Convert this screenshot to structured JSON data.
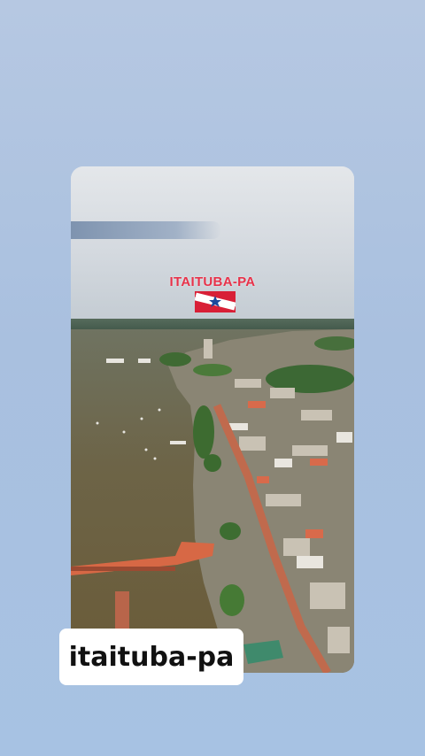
{
  "overlay": {
    "title": "ITAITUBA-PA",
    "flag_icon": "para-state-flag-icon",
    "title_color": "#e8324a"
  },
  "caption": {
    "text": "itaituba-pa"
  },
  "colors": {
    "background": "#a9c0df",
    "caption_bg": "#ffffff"
  }
}
